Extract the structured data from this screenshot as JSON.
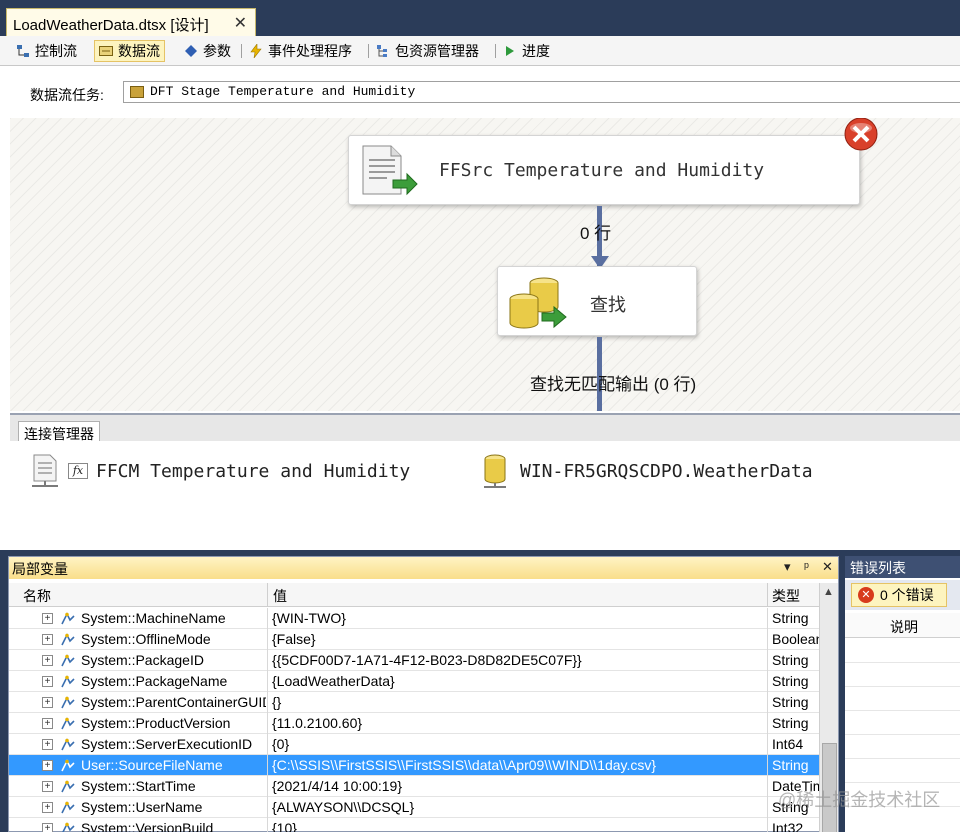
{
  "document_tab": {
    "title": "LoadWeatherData.dtsx [设计]",
    "close": "✕"
  },
  "toolbar": {
    "tabs": [
      {
        "label": "控制流",
        "icon": "control-flow-icon"
      },
      {
        "label": "数据流",
        "icon": "data-flow-icon",
        "active": true
      },
      {
        "label": "参数",
        "icon": "parameters-icon"
      },
      {
        "label": "事件处理程序",
        "icon": "event-handler-icon"
      },
      {
        "label": "包资源管理器",
        "icon": "package-explorer-icon"
      },
      {
        "label": "进度",
        "icon": "progress-icon"
      }
    ]
  },
  "task": {
    "label": "数据流任务:",
    "value": "DFT Stage Temperature and Humidity"
  },
  "canvas": {
    "source": {
      "label": "FFSrc Temperature and Humidity",
      "icon": "flat-file-source-icon",
      "error_icon": "error-x-icon"
    },
    "flow1_label": "0 行",
    "lookup": {
      "label": "查找",
      "icon": "lookup-icon"
    },
    "flow2_label": "查找无匹配输出 (0 行)"
  },
  "connection_manager": {
    "tab_label": "连接管理器",
    "items": [
      {
        "label": "FFCM Temperature and Humidity",
        "icon": "flat-file-connection-icon",
        "badge": "fx"
      },
      {
        "label": "WIN-FR5GRQSCDPO.WeatherData",
        "icon": "database-connection-icon"
      }
    ]
  },
  "locals": {
    "title": "局部变量",
    "title_controls": [
      "▾",
      "ᵖ",
      "✕"
    ],
    "columns": [
      "名称",
      "值",
      "类型"
    ],
    "rows": [
      {
        "name": "System::MachineName",
        "value": "{WIN-TWO}",
        "type": "String"
      },
      {
        "name": "System::OfflineMode",
        "value": "{False}",
        "type": "Boolean"
      },
      {
        "name": "System::PackageID",
        "value": "{{5CDF00D7-1A71-4F12-B023-D8D82DE5C07F}}",
        "type": "String"
      },
      {
        "name": "System::PackageName",
        "value": "{LoadWeatherData}",
        "type": "String"
      },
      {
        "name": "System::ParentContainerGUID",
        "value": "{}",
        "type": "String"
      },
      {
        "name": "System::ProductVersion",
        "value": "{11.0.2100.60}",
        "type": "String"
      },
      {
        "name": "System::ServerExecutionID",
        "value": "{0}",
        "type": "Int64"
      },
      {
        "name": "User::SourceFileName",
        "value": "{C:\\\\SSIS\\\\FirstSSIS\\\\FirstSSIS\\\\data\\\\Apr09\\\\WIND\\\\1day.csv}",
        "type": "String",
        "selected": true
      },
      {
        "name": "System::StartTime",
        "value": "{2021/4/14 10:00:19}",
        "type": "DateTime"
      },
      {
        "name": "System::UserName",
        "value": "{ALWAYSON\\\\DCSQL}",
        "type": "String"
      },
      {
        "name": "System::VersionBuild",
        "value": "{10}",
        "type": "Int32"
      }
    ]
  },
  "errors": {
    "title": "错误列表",
    "count_label": "0 个错误",
    "column": "说明"
  },
  "watermark": "@稀土掘金技术社区"
}
